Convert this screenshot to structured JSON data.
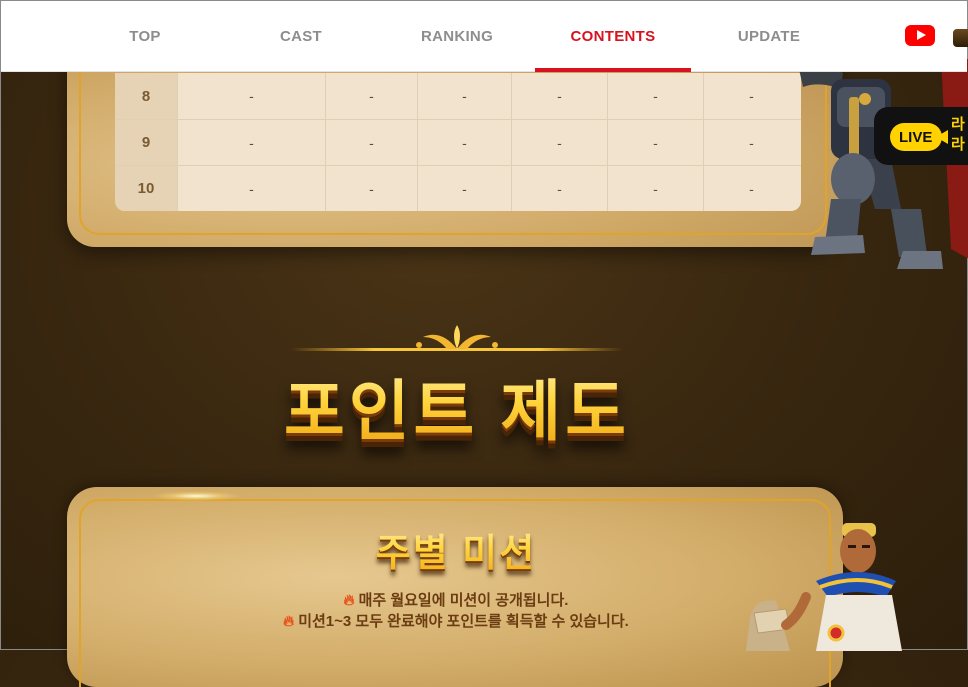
{
  "nav": {
    "items": [
      {
        "label": "TOP",
        "active": false
      },
      {
        "label": "CAST",
        "active": false
      },
      {
        "label": "RANKING",
        "active": false
      },
      {
        "label": "CONTENTS",
        "active": true
      },
      {
        "label": "UPDATE",
        "active": false
      }
    ],
    "youtube_icon": "youtube-icon",
    "active_color": "#d8121f"
  },
  "ranking_table": {
    "rows": [
      {
        "rank": "8",
        "cells": [
          "-",
          "-",
          "-",
          "-",
          "-",
          "-"
        ]
      },
      {
        "rank": "9",
        "cells": [
          "-",
          "-",
          "-",
          "-",
          "-",
          "-"
        ]
      },
      {
        "rank": "10",
        "cells": [
          "-",
          "-",
          "-",
          "-",
          "-",
          "-"
        ]
      }
    ]
  },
  "live_badge": {
    "pill": "LIVE",
    "text_line1": "라",
    "text_line2": "라"
  },
  "section": {
    "title": "포인트 제도"
  },
  "mission": {
    "title": "주별 미션",
    "line1": "매주 월요일에 미션이 공개됩니다.",
    "line2": "미션1~3 모두 완료해야 포인트를 획득할 수 있습니다."
  }
}
